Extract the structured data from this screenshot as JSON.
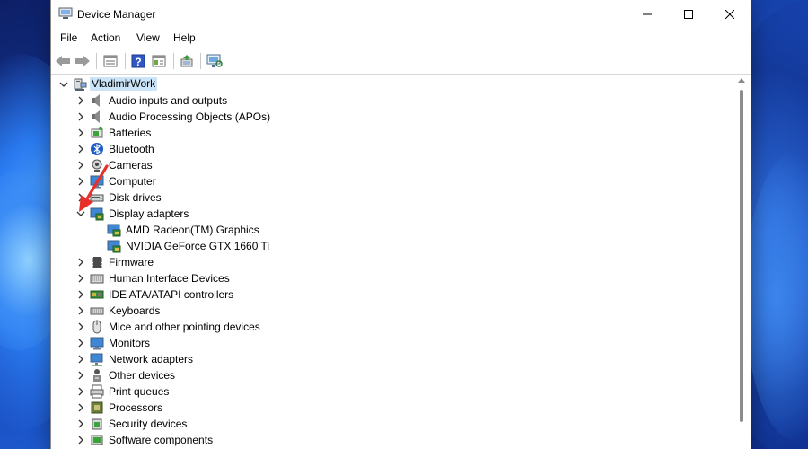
{
  "window": {
    "title": "Device Manager"
  },
  "menu": [
    "File",
    "Action",
    "View",
    "Help"
  ],
  "toolbar": [
    "back-icon",
    "forward-icon",
    "properties-view-icon",
    "help-icon",
    "show-hidden-icon",
    "update-driver-icon",
    "scan-hardware-icon"
  ],
  "tree": {
    "root": "VladimirWork",
    "categories": [
      "Audio inputs and outputs",
      "Audio Processing Objects (APOs)",
      "Batteries",
      "Bluetooth",
      "Cameras",
      "Computer",
      "Disk drives",
      "Display adapters",
      "Firmware",
      "Human Interface Devices",
      "IDE ATA/ATAPI controllers",
      "Keyboards",
      "Mice and other pointing devices",
      "Monitors",
      "Network adapters",
      "Other devices",
      "Print queues",
      "Processors",
      "Security devices",
      "Software components"
    ],
    "display_children": [
      "AMD Radeon(TM) Graphics",
      "NVIDIA GeForce GTX 1660 Ti"
    ]
  },
  "colors": {
    "selection": "#cce4f7",
    "annotation_arrow": "#e8302a"
  }
}
